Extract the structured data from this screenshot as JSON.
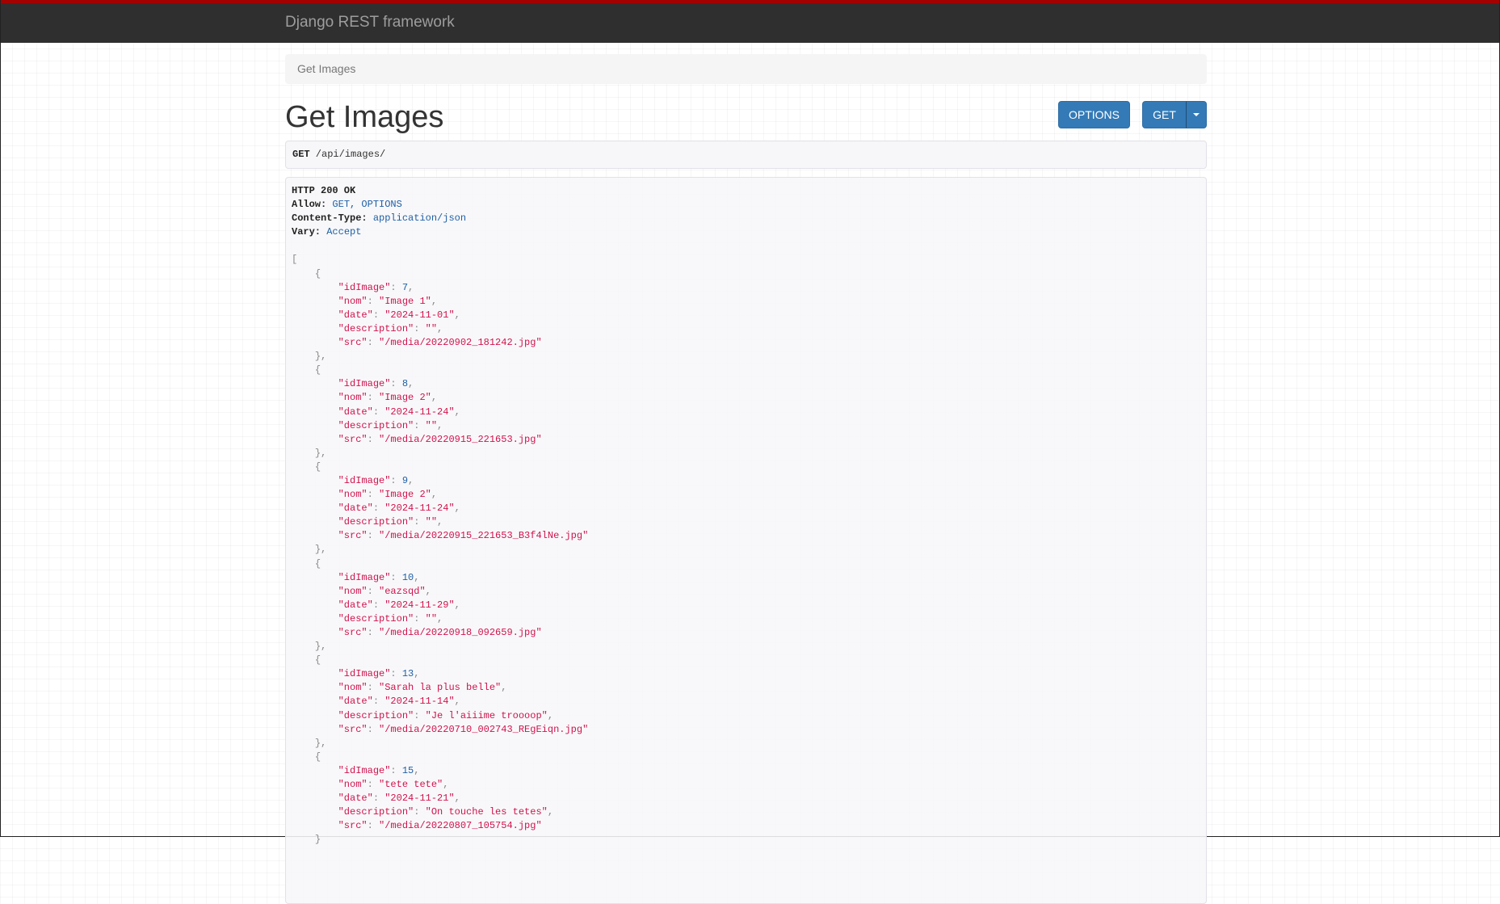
{
  "navbar": {
    "brand": "Django REST framework"
  },
  "breadcrumb": {
    "current": "Get Images"
  },
  "page": {
    "title": "Get Images",
    "options_button": "OPTIONS",
    "get_button": "GET"
  },
  "request": {
    "method": "GET",
    "path": " /api/images/"
  },
  "response": {
    "status": "HTTP 200 OK",
    "headers": [
      {
        "name": "Allow:",
        "value": "GET, OPTIONS"
      },
      {
        "name": "Content-Type:",
        "value": "application/json"
      },
      {
        "name": "Vary:",
        "value": "Accept"
      }
    ],
    "items": [
      {
        "idImage": 7,
        "nom": "Image 1",
        "date": "2024-11-01",
        "description": "",
        "src": "/media/20220902_181242.jpg"
      },
      {
        "idImage": 8,
        "nom": "Image 2",
        "date": "2024-11-24",
        "description": "",
        "src": "/media/20220915_221653.jpg"
      },
      {
        "idImage": 9,
        "nom": "Image 2",
        "date": "2024-11-24",
        "description": "",
        "src": "/media/20220915_221653_B3f4lNe.jpg"
      },
      {
        "idImage": 10,
        "nom": "eazsqd",
        "date": "2024-11-29",
        "description": "",
        "src": "/media/20220918_092659.jpg"
      },
      {
        "idImage": 13,
        "nom": "Sarah la plus belle",
        "date": "2024-11-14",
        "description": "Je l'aiiime troooop",
        "src": "/media/20220710_002743_REgEiqn.jpg"
      },
      {
        "idImage": 15,
        "nom": "tete tete",
        "date": "2024-11-21",
        "description": "On touche les tetes",
        "src": "/media/20220807_105754.jpg"
      }
    ]
  }
}
